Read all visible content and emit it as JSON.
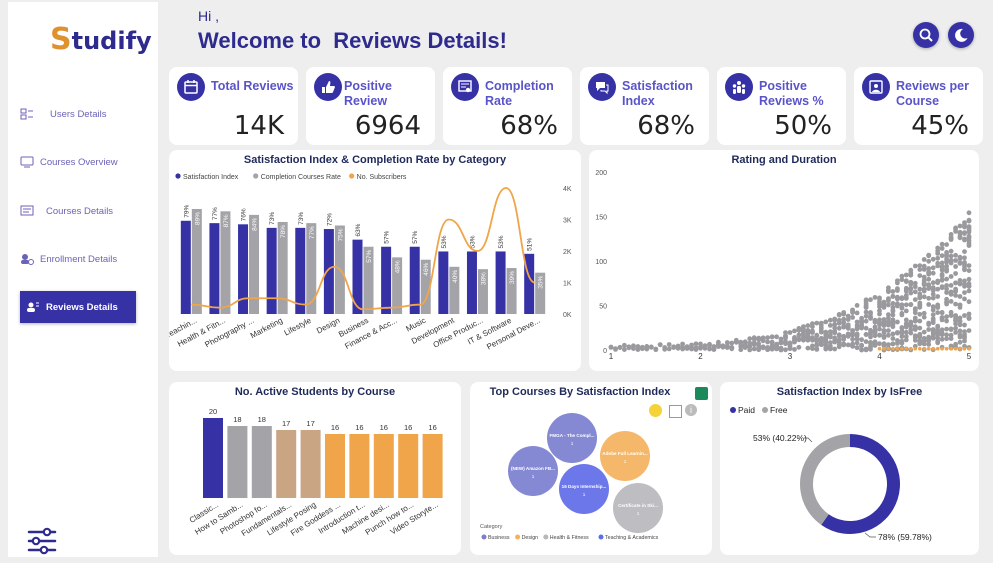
{
  "app": {
    "logo_first": "S",
    "logo_rest": "tudify"
  },
  "sidebar": {
    "items": [
      {
        "label": "Users Details",
        "icon": "users-details-icon"
      },
      {
        "label": "Courses Overview",
        "icon": "courses-overview-icon"
      },
      {
        "label": "Courses Details",
        "icon": "courses-details-icon"
      },
      {
        "label": "Enrollment Details",
        "icon": "enrollment-icon"
      },
      {
        "label": "Reviews Details",
        "icon": "reviews-icon",
        "active": true
      }
    ]
  },
  "header": {
    "greeting": "Hi ,",
    "title": "Welcome to  Reviews Details!"
  },
  "kpis": [
    {
      "label": "Total Reviews",
      "value": "14K",
      "icon": "calendar-icon"
    },
    {
      "label": "Positive Review",
      "value": "6964",
      "icon": "thumbs-up-icon"
    },
    {
      "label": "Completion Rate",
      "value": "68%",
      "icon": "certificate-icon"
    },
    {
      "label": "Satisfaction Index",
      "value": "68%",
      "icon": "chat-icon"
    },
    {
      "label": "Positive Reviews %",
      "value": "50%",
      "icon": "group-icon"
    },
    {
      "label": "Reviews per Course",
      "value": "45%",
      "icon": "course-icon"
    }
  ],
  "colors": {
    "primary": "#3632a6",
    "gray": "#a3a3a8",
    "orange": "#f0a54a",
    "tan": "#caa583"
  },
  "chart_data": [
    {
      "type": "bar",
      "title": "Satisfaction Index & Completion Rate by Category",
      "legend": [
        "Satisfaction Index",
        "Completion Courses Rate",
        "No. Subscribers"
      ],
      "categories": [
        "Teachin...",
        "Health & Fitn...",
        "Photography ...",
        "Marketing",
        "Lifestyle",
        "Design",
        "Business",
        "Finance & Acc...",
        "Music",
        "Development",
        "Office Produc...",
        "IT & Software",
        "Personal Deve..."
      ],
      "series": [
        {
          "name": "Satisfaction Index",
          "values": [
            79,
            77,
            76,
            73,
            73,
            72,
            63,
            57,
            57,
            53,
            53,
            53,
            51
          ]
        },
        {
          "name": "Completion Courses Rate",
          "values": [
            89,
            87,
            84,
            78,
            77,
            75,
            57,
            48,
            46,
            40,
            38,
            39,
            35
          ]
        },
        {
          "name": "No. Subscribers",
          "values": [
            300,
            200,
            500,
            500,
            300,
            1500,
            150,
            200,
            300,
            3000,
            2000,
            4000,
            1000
          ]
        }
      ],
      "labels_a": [
        "79%",
        "77%",
        "76%",
        "73%",
        "73%",
        "72%",
        "63%",
        "57%",
        "57%",
        "53%",
        "53%",
        "53%",
        "51%"
      ],
      "labels_b": [
        "89%",
        "87%",
        "84%",
        "78%",
        "77%",
        "75%",
        "57%",
        "48%",
        "46%",
        "40%",
        "38%",
        "39%",
        "35%"
      ],
      "y2_ticks": [
        "0K",
        "1K",
        "2K",
        "3K",
        "4K"
      ],
      "y2lim": [
        0,
        4000
      ]
    },
    {
      "type": "scatter",
      "title": "Rating and Duration",
      "x_ticks": [
        "1",
        "2",
        "3",
        "4",
        "5"
      ],
      "y_ticks": [
        "0",
        "50",
        "100",
        "150",
        "200"
      ],
      "xlim": [
        1,
        5
      ],
      "ylim": [
        0,
        200
      ]
    },
    {
      "type": "bar",
      "title": "No. Active Students by Course",
      "categories": [
        "Classic...",
        "How to Samb...",
        "Photoshop fo...",
        "Fundamentals...",
        "Lifestyle Posing",
        "Fire Goddess ...",
        "Introduction t...",
        "Machine desi...",
        "Punch how to...",
        "Video Storyte..."
      ],
      "values": [
        20,
        18,
        18,
        17,
        17,
        16,
        16,
        16,
        16,
        16
      ],
      "ylim": [
        0,
        20
      ]
    },
    {
      "type": "scatter",
      "title": "Top Courses By Satisfaction Index",
      "legend_title": "Category",
      "legend": [
        "Business",
        "Design",
        "Health & Fitness",
        "Teaching & Academics"
      ],
      "bubbles": [
        {
          "label": "FMGA - The Compl...",
          "value": "1",
          "category": "Business"
        },
        {
          "label": "Adobe Full Learnin...",
          "value": "1",
          "category": "Design"
        },
        {
          "label": "(NEW) Amazon FB...",
          "value": "1",
          "category": "Business"
        },
        {
          "label": "16 Days Internship...",
          "value": "1",
          "category": "Teaching & Academics"
        },
        {
          "label": "Certificate in Ski...",
          "value": "1",
          "category": "Health & Fitness"
        }
      ]
    },
    {
      "type": "pie",
      "title": "Satisfaction Index by IsFree",
      "legend": [
        "Paid",
        "Free"
      ],
      "values": [
        59.78,
        40.22
      ],
      "labels": [
        "78% (59.78%)",
        "53% (40.22%)"
      ]
    }
  ]
}
